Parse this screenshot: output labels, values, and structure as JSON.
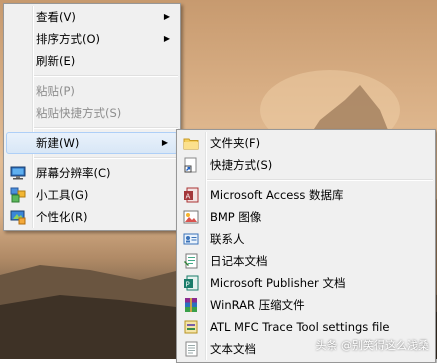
{
  "context_menu": {
    "items": [
      {
        "label": "查看(V)"
      },
      {
        "label": "排序方式(O)"
      },
      {
        "label": "刷新(E)"
      },
      {
        "label": "粘贴(P)"
      },
      {
        "label": "粘贴快捷方式(S)"
      },
      {
        "label": "新建(W)"
      },
      {
        "label": "屏幕分辨率(C)"
      },
      {
        "label": "小工具(G)"
      },
      {
        "label": "个性化(R)"
      }
    ]
  },
  "new_submenu": {
    "items": [
      {
        "label": "文件夹(F)",
        "icon": "folder-icon"
      },
      {
        "label": "快捷方式(S)",
        "icon": "shortcut-icon"
      },
      {
        "label": "Microsoft Access 数据库",
        "icon": "access-database-icon"
      },
      {
        "label": "BMP 图像",
        "icon": "bmp-image-icon"
      },
      {
        "label": "联系人",
        "icon": "contact-icon"
      },
      {
        "label": "日记本文档",
        "icon": "journal-document-icon"
      },
      {
        "label": "Microsoft Publisher 文档",
        "icon": "publisher-document-icon"
      },
      {
        "label": "WinRAR 压缩文件",
        "icon": "winrar-archive-icon"
      },
      {
        "label": "ATL MFC Trace Tool settings file",
        "icon": "trace-tool-settings-icon"
      },
      {
        "label": "文本文档",
        "icon": "text-document-icon"
      }
    ]
  },
  "watermark": "头条 @别笑得这么浅桑"
}
